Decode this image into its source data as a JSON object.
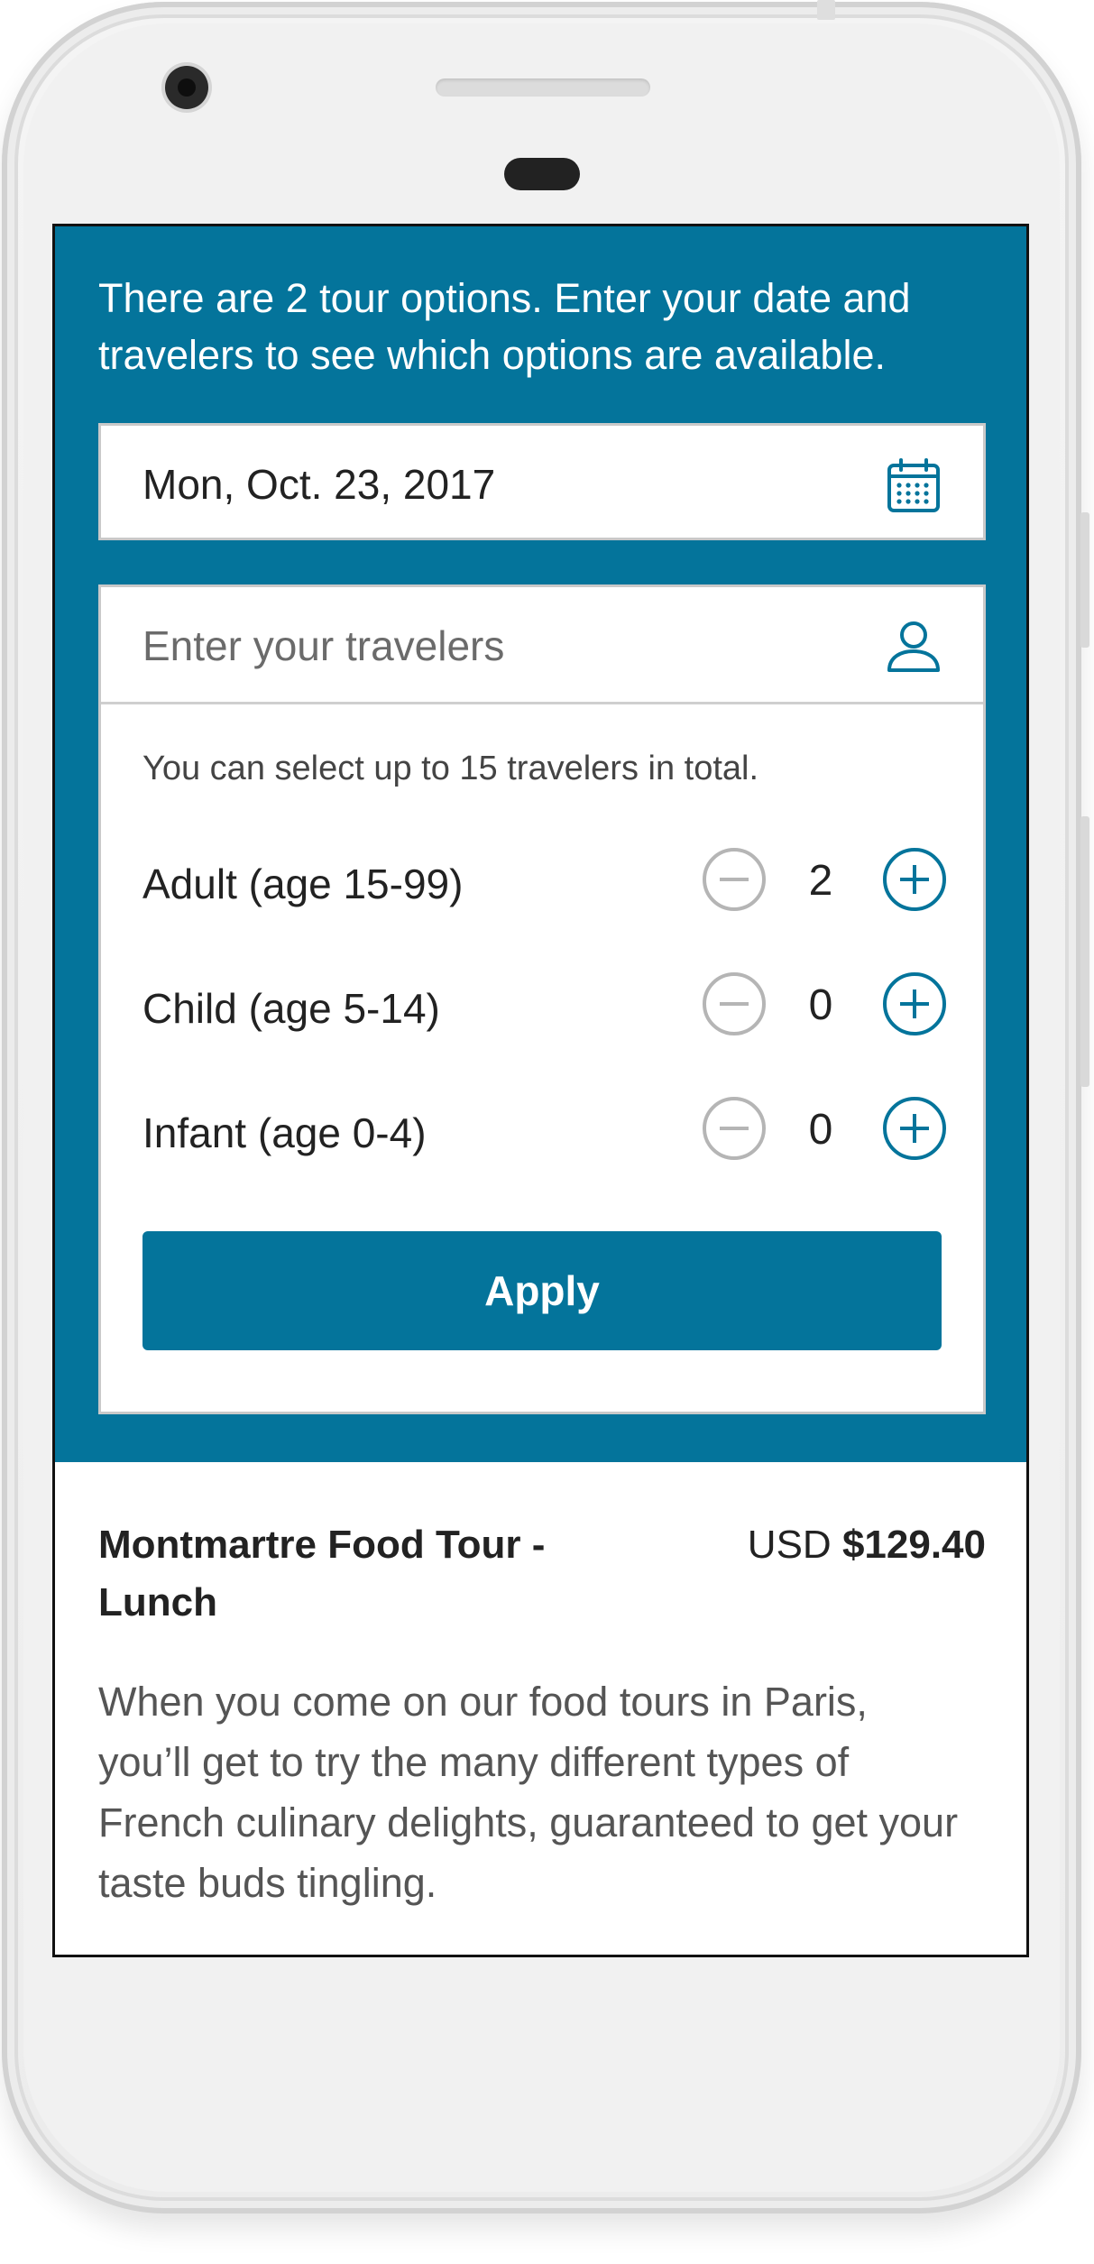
{
  "intro_text": "There are 2 tour options. Enter your date and travelers to see which options are available.",
  "date_field": {
    "value": "Mon, Oct. 23, 2017",
    "icon": "calendar-icon"
  },
  "travelers": {
    "placeholder": "Enter your travelers",
    "icon": "person-icon",
    "hint": "You can select up to 15 travelers in total.",
    "rows": [
      {
        "label": "Adult (age 15-99)",
        "count": "2"
      },
      {
        "label": "Child (age 5-14)",
        "count": "0"
      },
      {
        "label": "Infant (age 0-4)",
        "count": "0"
      }
    ],
    "apply_label": "Apply"
  },
  "tour": {
    "title": "Montmartre Food Tour - Lunch",
    "currency": "USD",
    "price": "$129.40",
    "description": "When you come on our food tours in Paris, you’ll get to try the many different types of French culinary delights, guaranteed to get your taste buds tingling."
  },
  "colors": {
    "brand": "#04749b",
    "stepper_disabled": "#b5b5b5"
  }
}
